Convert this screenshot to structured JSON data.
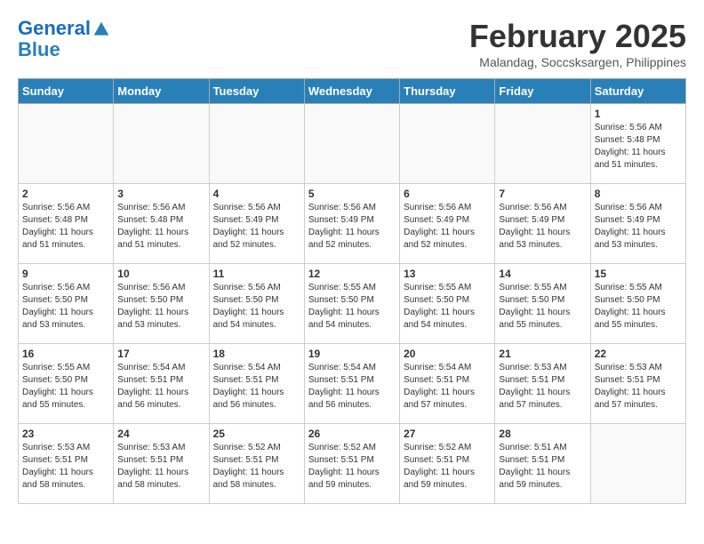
{
  "logo": {
    "line1": "General",
    "line2": "Blue"
  },
  "title": "February 2025",
  "location": "Malandag, Soccsksargen, Philippines",
  "days_of_week": [
    "Sunday",
    "Monday",
    "Tuesday",
    "Wednesday",
    "Thursday",
    "Friday",
    "Saturday"
  ],
  "weeks": [
    {
      "days": [
        {
          "number": "",
          "info": "",
          "empty": true
        },
        {
          "number": "",
          "info": "",
          "empty": true
        },
        {
          "number": "",
          "info": "",
          "empty": true
        },
        {
          "number": "",
          "info": "",
          "empty": true
        },
        {
          "number": "",
          "info": "",
          "empty": true
        },
        {
          "number": "",
          "info": "",
          "empty": true
        },
        {
          "number": "1",
          "info": "Sunrise: 5:56 AM\nSunset: 5:48 PM\nDaylight: 11 hours\nand 51 minutes."
        }
      ]
    },
    {
      "days": [
        {
          "number": "2",
          "info": "Sunrise: 5:56 AM\nSunset: 5:48 PM\nDaylight: 11 hours\nand 51 minutes."
        },
        {
          "number": "3",
          "info": "Sunrise: 5:56 AM\nSunset: 5:48 PM\nDaylight: 11 hours\nand 51 minutes."
        },
        {
          "number": "4",
          "info": "Sunrise: 5:56 AM\nSunset: 5:49 PM\nDaylight: 11 hours\nand 52 minutes."
        },
        {
          "number": "5",
          "info": "Sunrise: 5:56 AM\nSunset: 5:49 PM\nDaylight: 11 hours\nand 52 minutes."
        },
        {
          "number": "6",
          "info": "Sunrise: 5:56 AM\nSunset: 5:49 PM\nDaylight: 11 hours\nand 52 minutes."
        },
        {
          "number": "7",
          "info": "Sunrise: 5:56 AM\nSunset: 5:49 PM\nDaylight: 11 hours\nand 53 minutes."
        },
        {
          "number": "8",
          "info": "Sunrise: 5:56 AM\nSunset: 5:49 PM\nDaylight: 11 hours\nand 53 minutes."
        }
      ]
    },
    {
      "days": [
        {
          "number": "9",
          "info": "Sunrise: 5:56 AM\nSunset: 5:50 PM\nDaylight: 11 hours\nand 53 minutes."
        },
        {
          "number": "10",
          "info": "Sunrise: 5:56 AM\nSunset: 5:50 PM\nDaylight: 11 hours\nand 53 minutes."
        },
        {
          "number": "11",
          "info": "Sunrise: 5:56 AM\nSunset: 5:50 PM\nDaylight: 11 hours\nand 54 minutes."
        },
        {
          "number": "12",
          "info": "Sunrise: 5:55 AM\nSunset: 5:50 PM\nDaylight: 11 hours\nand 54 minutes."
        },
        {
          "number": "13",
          "info": "Sunrise: 5:55 AM\nSunset: 5:50 PM\nDaylight: 11 hours\nand 54 minutes."
        },
        {
          "number": "14",
          "info": "Sunrise: 5:55 AM\nSunset: 5:50 PM\nDaylight: 11 hours\nand 55 minutes."
        },
        {
          "number": "15",
          "info": "Sunrise: 5:55 AM\nSunset: 5:50 PM\nDaylight: 11 hours\nand 55 minutes."
        }
      ]
    },
    {
      "days": [
        {
          "number": "16",
          "info": "Sunrise: 5:55 AM\nSunset: 5:50 PM\nDaylight: 11 hours\nand 55 minutes."
        },
        {
          "number": "17",
          "info": "Sunrise: 5:54 AM\nSunset: 5:51 PM\nDaylight: 11 hours\nand 56 minutes."
        },
        {
          "number": "18",
          "info": "Sunrise: 5:54 AM\nSunset: 5:51 PM\nDaylight: 11 hours\nand 56 minutes."
        },
        {
          "number": "19",
          "info": "Sunrise: 5:54 AM\nSunset: 5:51 PM\nDaylight: 11 hours\nand 56 minutes."
        },
        {
          "number": "20",
          "info": "Sunrise: 5:54 AM\nSunset: 5:51 PM\nDaylight: 11 hours\nand 57 minutes."
        },
        {
          "number": "21",
          "info": "Sunrise: 5:53 AM\nSunset: 5:51 PM\nDaylight: 11 hours\nand 57 minutes."
        },
        {
          "number": "22",
          "info": "Sunrise: 5:53 AM\nSunset: 5:51 PM\nDaylight: 11 hours\nand 57 minutes."
        }
      ]
    },
    {
      "days": [
        {
          "number": "23",
          "info": "Sunrise: 5:53 AM\nSunset: 5:51 PM\nDaylight: 11 hours\nand 58 minutes."
        },
        {
          "number": "24",
          "info": "Sunrise: 5:53 AM\nSunset: 5:51 PM\nDaylight: 11 hours\nand 58 minutes."
        },
        {
          "number": "25",
          "info": "Sunrise: 5:52 AM\nSunset: 5:51 PM\nDaylight: 11 hours\nand 58 minutes."
        },
        {
          "number": "26",
          "info": "Sunrise: 5:52 AM\nSunset: 5:51 PM\nDaylight: 11 hours\nand 59 minutes."
        },
        {
          "number": "27",
          "info": "Sunrise: 5:52 AM\nSunset: 5:51 PM\nDaylight: 11 hours\nand 59 minutes."
        },
        {
          "number": "28",
          "info": "Sunrise: 5:51 AM\nSunset: 5:51 PM\nDaylight: 11 hours\nand 59 minutes."
        },
        {
          "number": "",
          "info": "",
          "empty": true
        }
      ]
    }
  ]
}
